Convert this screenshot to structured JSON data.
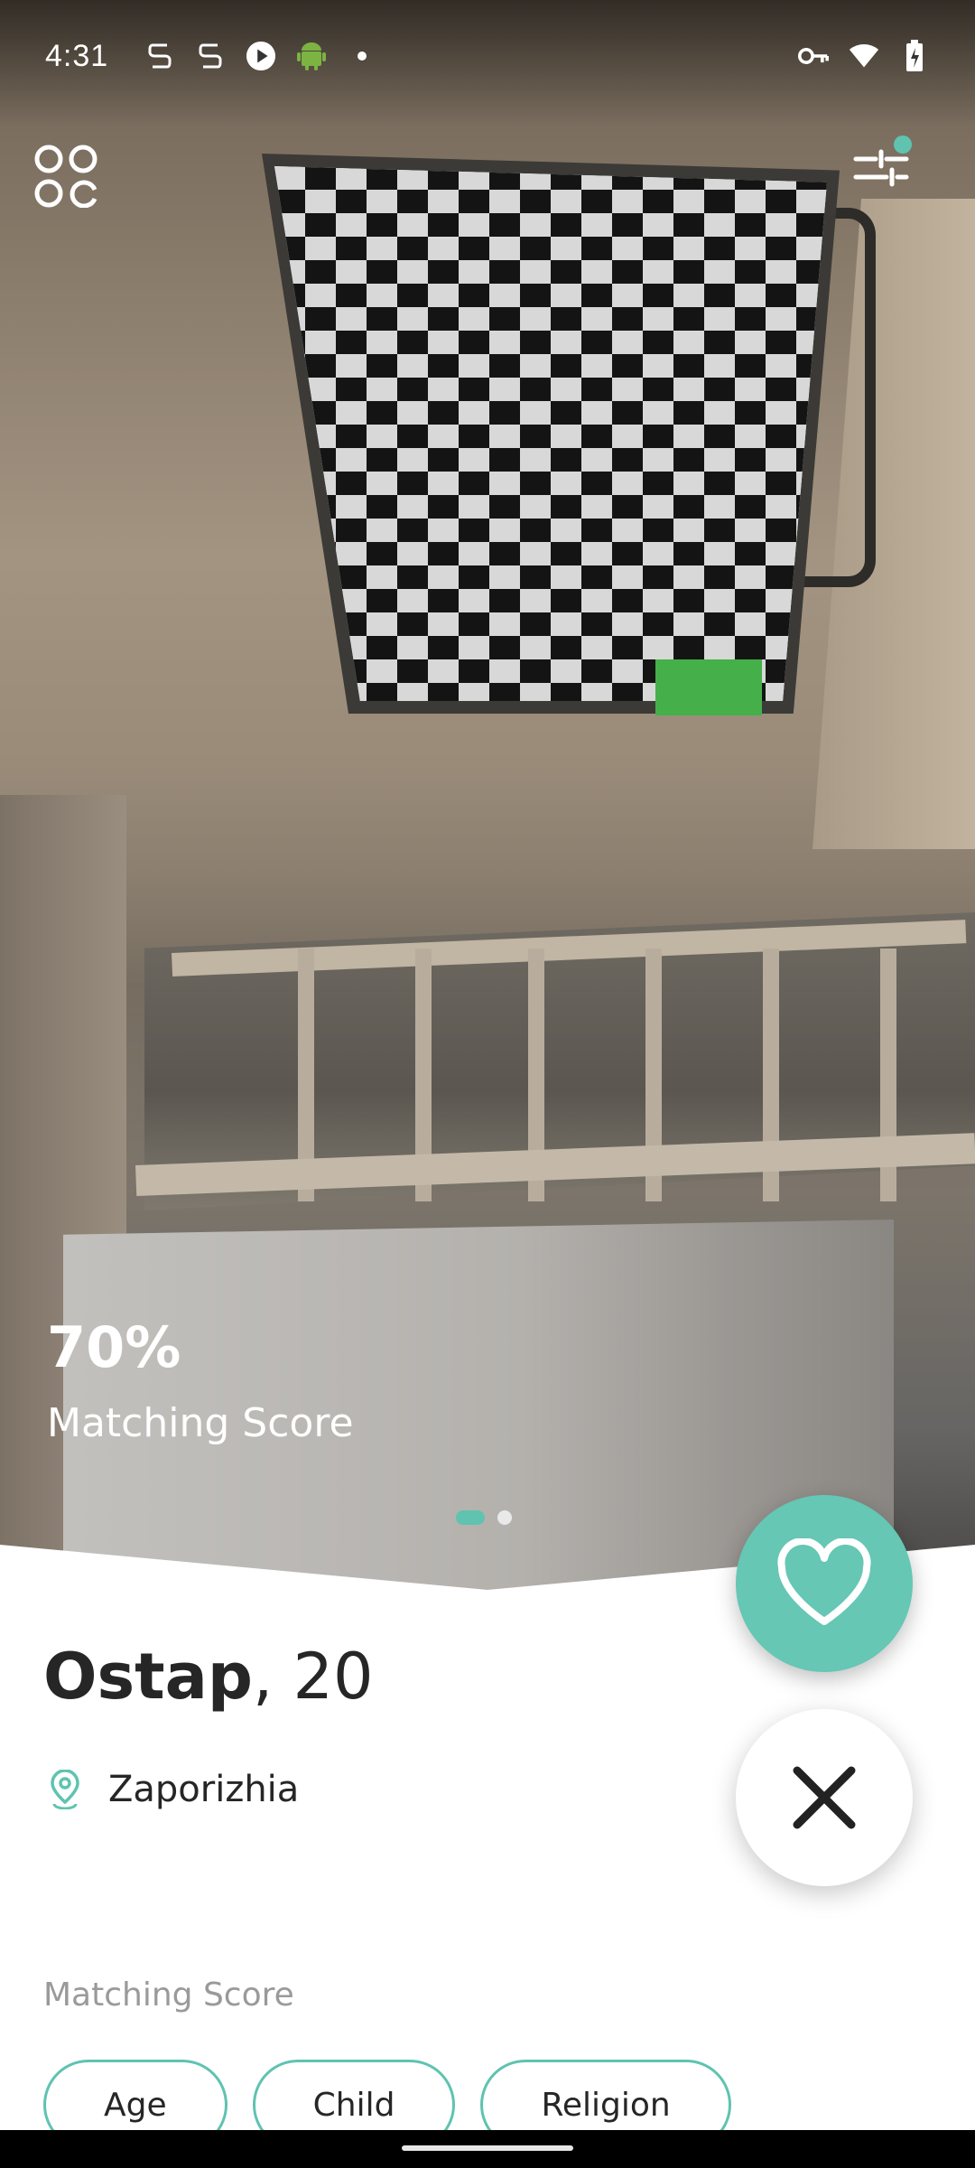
{
  "status_bar": {
    "time": "4:31",
    "left_icons": [
      "notification-s-icon",
      "notification-s-icon",
      "media-play-icon",
      "android-icon",
      "more-dot-icon"
    ],
    "right_icons": [
      "vpn-key-icon",
      "wifi-icon",
      "battery-icon"
    ]
  },
  "top_bar": {
    "menu_icon": "grid-menu-icon",
    "filter_icon": "filter-sliders-icon",
    "filter_badge_color": "#5fc3b0"
  },
  "photo": {
    "score_percent": "70%",
    "score_label": "Matching Score",
    "pages_total": 2,
    "active_page": 1
  },
  "profile": {
    "name": "Ostap",
    "age_suffix": ", 20",
    "location": "Zaporizhia",
    "location_icon": "map-pin-icon"
  },
  "actions": {
    "like_icon": "heart-icon",
    "dislike_icon": "close-icon",
    "accent_color": "#65c7b4"
  },
  "matching": {
    "title": "Matching Score",
    "chips": [
      "Age",
      "Child",
      "Religion"
    ]
  }
}
